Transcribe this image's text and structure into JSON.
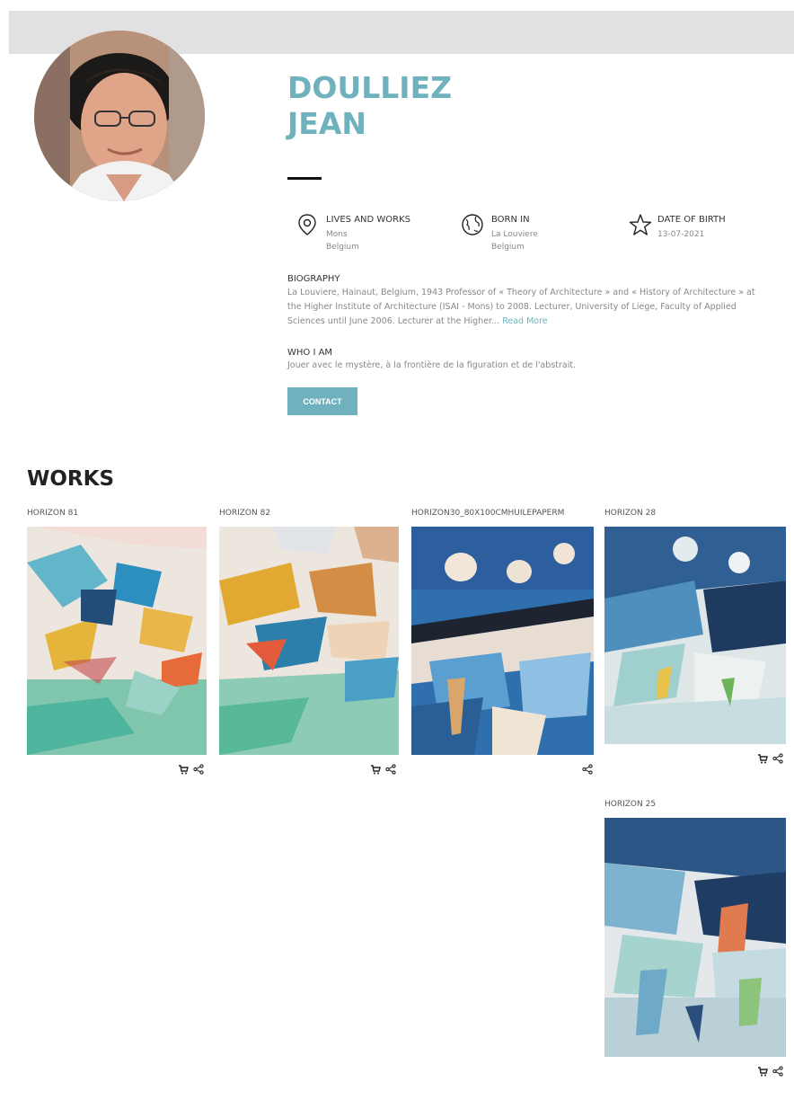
{
  "artist": {
    "last_name": "DOULLIEZ",
    "first_name": "JEAN"
  },
  "info": [
    {
      "title": "LIVES AND WORKS",
      "line1": "Mons",
      "line2": "Belgium",
      "icon": "map-pin-icon"
    },
    {
      "title": "BORN IN",
      "line1": "La Louviere",
      "line2": "Belgium",
      "icon": "globe-icon"
    },
    {
      "title": "DATE OF BIRTH",
      "line1": "13-07-2021",
      "line2": "",
      "icon": "star-icon"
    }
  ],
  "biography": {
    "title": "BIOGRAPHY",
    "text": "La Louviere, Hainaut, Belgium, 1943 Professor of « Theory of Architecture » and « History of Architecture » at the Higher Institute of Architecture (ISAI - Mons) to 2008. Lecturer, University of Liege, Faculty of Applied Sciences until June 2006. Lecturer at the Higher...",
    "read_more": "Read More"
  },
  "who_i_am": {
    "title": "WHO I AM",
    "text": "Jouer avec le mystère, à la frontière de la figuration et de l'abstrait."
  },
  "contact_label": "CONTACT",
  "works_title": "WORKS",
  "works": [
    {
      "title": "HORIZON 81"
    },
    {
      "title": "HORIZON 82"
    },
    {
      "title": "HORIZON30_80X100CMHUILEPAPERM"
    },
    {
      "title": "HORIZON 28"
    },
    {
      "title": "HORIZON 25"
    }
  ],
  "colors": {
    "accent": "#6fb2bd",
    "header_band": "#e1e1e1"
  }
}
